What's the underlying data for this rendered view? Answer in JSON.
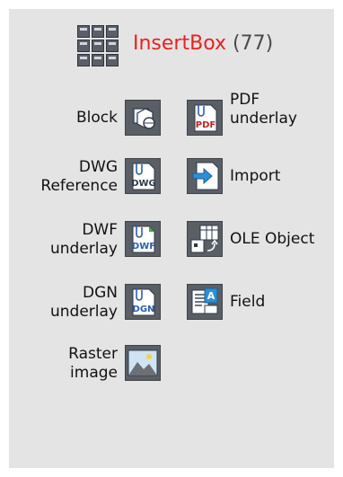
{
  "header": {
    "name": "InsertBox",
    "count": "(77)",
    "icon": "grid-icon"
  },
  "left_items": [
    {
      "label": "Block",
      "icon": "block-icon"
    },
    {
      "label": "DWG\nReference",
      "icon": "dwg-reference-icon"
    },
    {
      "label": "DWF\nunderlay",
      "icon": "dwf-underlay-icon"
    },
    {
      "label": "DGN\nunderlay",
      "icon": "dgn-underlay-icon"
    },
    {
      "label": "Raster\nimage",
      "icon": "raster-image-icon"
    }
  ],
  "right_items": [
    {
      "label": "PDF\nunderlay",
      "icon": "pdf-underlay-icon"
    },
    {
      "label": "Import",
      "icon": "import-icon"
    },
    {
      "label": "OLE Object",
      "icon": "ole-object-icon"
    },
    {
      "label": "Field",
      "icon": "field-icon"
    }
  ],
  "colors": {
    "panel": "#e4e4e4",
    "title_accent": "#e52320",
    "count": "#4a4a4a",
    "icon_bg": "#5a5f66"
  }
}
